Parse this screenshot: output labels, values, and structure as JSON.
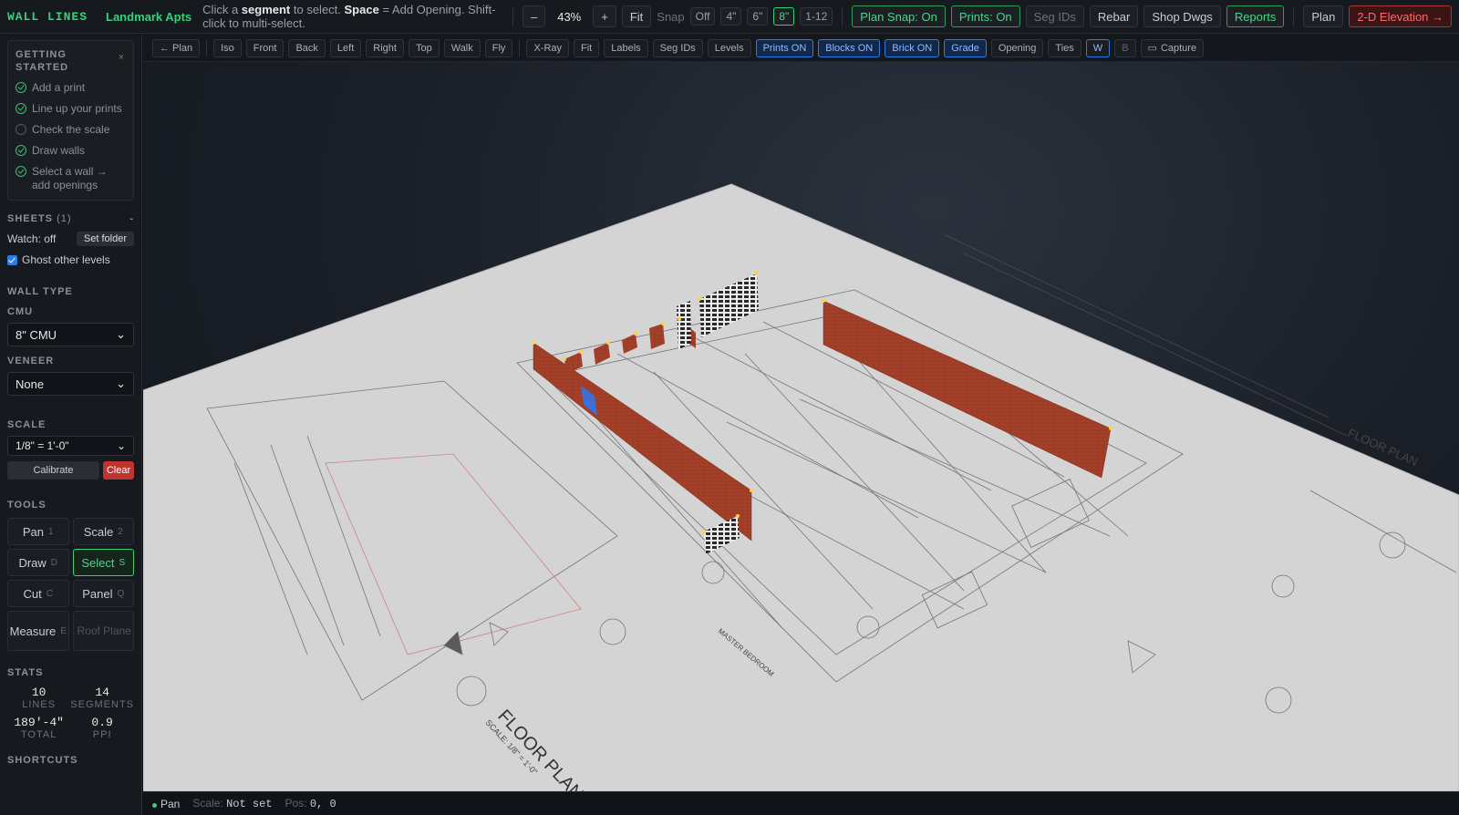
{
  "app": {
    "brand": "WALL LINES",
    "project": "Landmark Apts"
  },
  "hint": {
    "pre": "Click a ",
    "seg": "segment",
    "mid": " to select. ",
    "space": "Space",
    "post": " = Add Opening. Shift-click to multi-select."
  },
  "toolbar": {
    "zoom_out": "–",
    "zoom": "43%",
    "zoom_in": "+",
    "fit": "Fit",
    "snap_label": "Snap",
    "snap": [
      "Off",
      "4\"",
      "6\"",
      "8\"",
      "1-12"
    ],
    "snap_active": "8\"",
    "plan_snap": "Plan Snap: On",
    "prints": "Prints: On",
    "seg_ids": "Seg IDs",
    "rebar": "Rebar",
    "shop_dwgs": "Shop Dwgs",
    "reports": "Reports",
    "plan": "Plan",
    "elevation": "2-D Elevation →"
  },
  "getting_started": {
    "title": "GETTING STARTED",
    "close": "×",
    "items": [
      {
        "label": "Add a print",
        "done": true
      },
      {
        "label": "Line up your prints",
        "done": true
      },
      {
        "label": "Check the scale",
        "done": false
      },
      {
        "label": "Draw walls",
        "done": true
      },
      {
        "label": "Select a wall → add openings",
        "done": true
      }
    ]
  },
  "sheets": {
    "title": "SHEETS",
    "count": "(1)",
    "toggle": "-",
    "watch": "Watch: off",
    "set_folder": "Set folder",
    "ghost": "Ghost other levels"
  },
  "wall_type": {
    "title": "WALL TYPE",
    "cmu_label": "CMU",
    "cmu_value": "8\" CMU",
    "veneer_label": "VENEER",
    "veneer_value": "None"
  },
  "scale": {
    "title": "SCALE",
    "value": "1/8\" = 1'-0\"",
    "calibrate": "Calibrate",
    "clear": "Clear"
  },
  "tools": {
    "title": "TOOLS",
    "pan": "Pan",
    "pan_key": "1",
    "scale": "Scale",
    "scale_key": "2",
    "draw": "Draw",
    "draw_key": "D",
    "select": "Select",
    "select_key": "S",
    "cut": "Cut",
    "cut_key": "C",
    "panel": "Panel",
    "panel_key": "Q",
    "measure": "Measure",
    "measure_key": "E",
    "roof": "Roof Plane"
  },
  "stats": {
    "title": "STATS",
    "lines": "10",
    "lines_label": "LINES",
    "segments": "14",
    "segments_label": "SEGMENTS",
    "total": "189'-4\"",
    "total_label": "TOTAL",
    "ppi": "0.9",
    "ppi_label": "PPI"
  },
  "shortcuts": {
    "title": "SHORTCUTS"
  },
  "viewbar": {
    "back_plan": "← Plan",
    "iso": "Iso",
    "front": "Front",
    "back": "Back",
    "left": "Left",
    "right": "Right",
    "top": "Top",
    "walk": "Walk",
    "fly": "Fly",
    "xray": "X-Ray",
    "fit": "Fit",
    "labels": "Labels",
    "segids": "Seg IDs",
    "levels": "Levels",
    "prints_on": "Prints ON",
    "blocks_on": "Blocks ON",
    "brick_on": "Brick ON",
    "grade": "Grade",
    "opening": "Opening",
    "ties": "Ties",
    "w": "W",
    "b": "B",
    "capture": "Capture"
  },
  "plan_text": {
    "floor_plan": "FLOOR PLAN",
    "scale_note": "SCALE: 1/8\" = 1'-0\"",
    "master": "MASTER BEDROOM",
    "floor_plan_right": "FLOOR PLAN"
  },
  "status": {
    "mode": "Pan",
    "scale_label": "Scale:",
    "scale_value": "Not set",
    "pos_label": "Pos:",
    "pos_value": "0, 0"
  },
  "colors": {
    "accent": "#34d27a",
    "brick": "#a3402a",
    "selection": "#2f7be5",
    "danger": "#c0332f"
  }
}
